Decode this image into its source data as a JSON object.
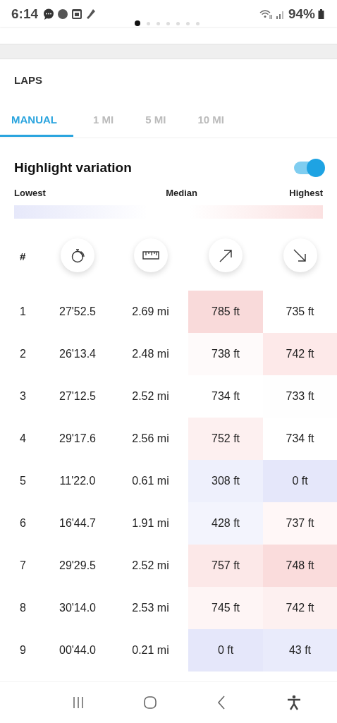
{
  "status_bar": {
    "time": "6:14",
    "battery": "94%"
  },
  "pager": [
    {
      "selected": true
    },
    {
      "selected": false
    },
    {
      "selected": false
    },
    {
      "selected": false
    },
    {
      "selected": false
    },
    {
      "selected": false
    },
    {
      "selected": false
    }
  ],
  "section_title": "LAPS",
  "tabs": [
    {
      "label": "MANUAL",
      "selected": true
    },
    {
      "label": "1 MI",
      "selected": false
    },
    {
      "label": "5 MI",
      "selected": false
    },
    {
      "label": "10 MI",
      "selected": false
    }
  ],
  "highlight": {
    "label": "Highlight variation",
    "on": true
  },
  "legend": {
    "low": "Lowest",
    "mid": "Median",
    "high": "Highest"
  },
  "table": {
    "number_header": "#",
    "rows": [
      {
        "n": "1",
        "time": "27'52.5",
        "distance": "2.69 mi",
        "ascent": {
          "text": "785 ft",
          "color": "#f9dada"
        },
        "descent": {
          "text": "735 ft",
          "color": "#ffffff"
        }
      },
      {
        "n": "2",
        "time": "26'13.4",
        "distance": "2.48 mi",
        "ascent": {
          "text": "738 ft",
          "color": "#fefafa"
        },
        "descent": {
          "text": "742 ft",
          "color": "#fde9e9"
        }
      },
      {
        "n": "3",
        "time": "27'12.5",
        "distance": "2.52 mi",
        "ascent": {
          "text": "734 ft",
          "color": "#ffffff"
        },
        "descent": {
          "text": "733 ft",
          "color": "#fefefe"
        }
      },
      {
        "n": "4",
        "time": "29'17.6",
        "distance": "2.56 mi",
        "ascent": {
          "text": "752 ft",
          "color": "#fdf0f0"
        },
        "descent": {
          "text": "734 ft",
          "color": "#ffffff"
        }
      },
      {
        "n": "5",
        "time": "11'22.0",
        "distance": "0.61 mi",
        "ascent": {
          "text": "308 ft",
          "color": "#eef0fc"
        },
        "descent": {
          "text": "0 ft",
          "color": "#e5e7fa"
        }
      },
      {
        "n": "6",
        "time": "16'44.7",
        "distance": "1.91 mi",
        "ascent": {
          "text": "428 ft",
          "color": "#f3f4fd"
        },
        "descent": {
          "text": "737 ft",
          "color": "#fff7f7"
        }
      },
      {
        "n": "7",
        "time": "29'29.5",
        "distance": "2.52 mi",
        "ascent": {
          "text": "757 ft",
          "color": "#fce8e8"
        },
        "descent": {
          "text": "748 ft",
          "color": "#fadcdc"
        }
      },
      {
        "n": "8",
        "time": "30'14.0",
        "distance": "2.53 mi",
        "ascent": {
          "text": "745 ft",
          "color": "#fef5f5"
        },
        "descent": {
          "text": "742 ft",
          "color": "#fdf0f0"
        }
      },
      {
        "n": "9",
        "time": "00'44.0",
        "distance": "0.21 mi",
        "ascent": {
          "text": "0 ft",
          "color": "#e5e7fa"
        },
        "descent": {
          "text": "43 ft",
          "color": "#e9ebfb"
        }
      }
    ]
  }
}
